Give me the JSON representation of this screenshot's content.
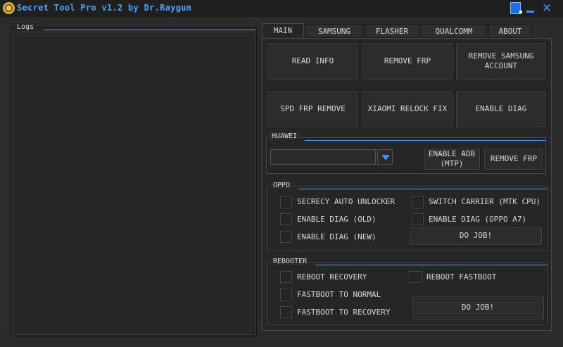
{
  "window": {
    "title": "Secret Tool Pro v1.2 by Dr.Raygun"
  },
  "logs": {
    "title": "Logs"
  },
  "tabs": [
    {
      "label": "MAIN"
    },
    {
      "label": "SAMSUNG"
    },
    {
      "label": "FLASHER"
    },
    {
      "label": "QUALCOMM"
    },
    {
      "label": "ABOUT"
    }
  ],
  "main": {
    "read_info": "READ INFO",
    "remove_frp": "REMOVE FRP",
    "remove_samsung_account": "REMOVE SAMSUNG ACCOUNT",
    "spd_frp_remove": "SPD FRP REMOVE",
    "xiaomi_relock_fix": "XIAOMI RELOCK FIX",
    "enable_diag": "ENABLE DIAG"
  },
  "huawei": {
    "title": "HUAWEI",
    "selected_value": "",
    "enable_adb": "ENABLE ADB (MTP)",
    "remove_frp": "REMOVE FRP"
  },
  "oppo": {
    "title": "OPPO",
    "secrecy_auto_unlocker": "SECRECY AUTO UNLOCKER",
    "enable_diag_old": "ENABLE DIAG (OLD)",
    "enable_diag_new": "ENABLE DIAG (NEW)",
    "switch_carrier": "SWITCH CARRIER (MTK CPU)",
    "enable_diag_oppo_a7": "ENABLE DIAG (OPPO A7)",
    "do_job": "DO JOB!"
  },
  "rebooter": {
    "title": "REBOOTER",
    "reboot_recovery": "REBOOT RECOVERY",
    "fastboot_to_normal": "FASTBOOT TO NORMAL",
    "fastboot_to_recovery": "FASTBOOT TO RECOVERY",
    "reboot_fastboot": "REBOOT FASTBOOT",
    "do_job": "DO JOB!"
  },
  "colors": {
    "accent": "#3a95ff",
    "background": "#2b2b2b",
    "title_text": "#4aa3ff"
  },
  "icons": {
    "logo": "app-logo-icon",
    "close": "close-icon",
    "minimize": "minimize-icon",
    "theme": "theme-icon",
    "dropdown": "chevron-down-icon"
  }
}
